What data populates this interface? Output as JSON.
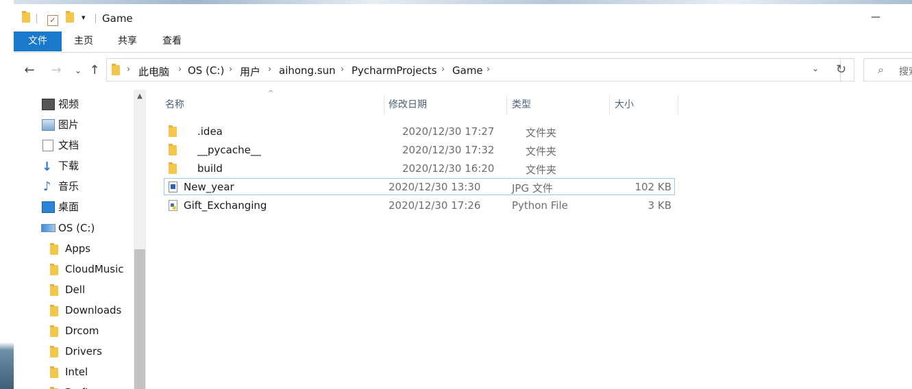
{
  "window": {
    "title": "Game",
    "minimize_glyph": "—"
  },
  "ribbon": {
    "tabs": [
      "文件",
      "主页",
      "共享",
      "查看"
    ]
  },
  "address": {
    "crumbs": [
      "此电脑",
      "OS (C:)",
      "用户",
      "aihong.sun",
      "PycharmProjects",
      "Game"
    ],
    "search_placeholder": "搜索\"Game\""
  },
  "nav": {
    "quick_items": [
      {
        "label": "视频",
        "icon": "video-icon"
      },
      {
        "label": "图片",
        "icon": "pictures-icon"
      },
      {
        "label": "文档",
        "icon": "documents-icon"
      },
      {
        "label": "下载",
        "icon": "downloads-icon"
      },
      {
        "label": "音乐",
        "icon": "music-icon"
      },
      {
        "label": "桌面",
        "icon": "desktop-icon"
      }
    ],
    "drive": {
      "label": "OS (C:)",
      "icon": "drive-icon"
    },
    "folders": [
      "Apps",
      "CloudMusic",
      "Dell",
      "Downloads",
      "Drcom",
      "Drivers",
      "Intel",
      "PerfLogs"
    ]
  },
  "columns": {
    "name": "名称",
    "date": "修改日期",
    "type": "类型",
    "size": "大小"
  },
  "files": [
    {
      "name": ".idea",
      "date": "2020/12/30 17:27",
      "type": "文件夹",
      "size": "",
      "icon": "folder-icon"
    },
    {
      "name": "__pycache__",
      "date": "2020/12/30 17:32",
      "type": "文件夹",
      "size": "",
      "icon": "folder-icon"
    },
    {
      "name": "build",
      "date": "2020/12/30 16:20",
      "type": "文件夹",
      "size": "",
      "icon": "folder-icon"
    },
    {
      "name": "New_year",
      "date": "2020/12/30 13:30",
      "type": "JPG 文件",
      "size": "102 KB",
      "icon": "image-file-icon",
      "selected": true
    },
    {
      "name": "Gift_Exchanging",
      "date": "2020/12/30 17:26",
      "type": "Python File",
      "size": "3 KB",
      "icon": "python-file-icon"
    }
  ],
  "colors": {
    "file_tab": "#1979ca",
    "folder": "#f3c74c",
    "selection_border": "#99c9ef"
  }
}
